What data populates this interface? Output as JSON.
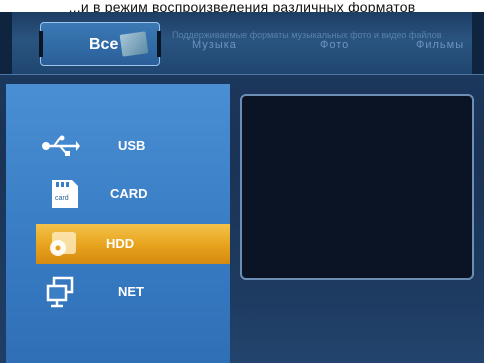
{
  "caption": "...и в режим воспроизведения различных форматов",
  "header": {
    "active_tab": "Все",
    "scroll_text": "Поддерживаемые форматы музыкальных фото и видео файлов",
    "tabs": [
      "Музыка",
      "Фото",
      "Фильмы"
    ]
  },
  "sources": [
    {
      "label": "USB",
      "icon": "usb-icon",
      "selected": false
    },
    {
      "label": "CARD",
      "icon": "card-icon",
      "selected": false
    },
    {
      "label": "HDD",
      "icon": "hdd-icon",
      "selected": true
    },
    {
      "label": "NET",
      "icon": "network-icon",
      "selected": false
    }
  ],
  "colors": {
    "panel": "#3a7ec6",
    "highlight": "#e7a21d",
    "preview_bg": "#0a1424"
  }
}
